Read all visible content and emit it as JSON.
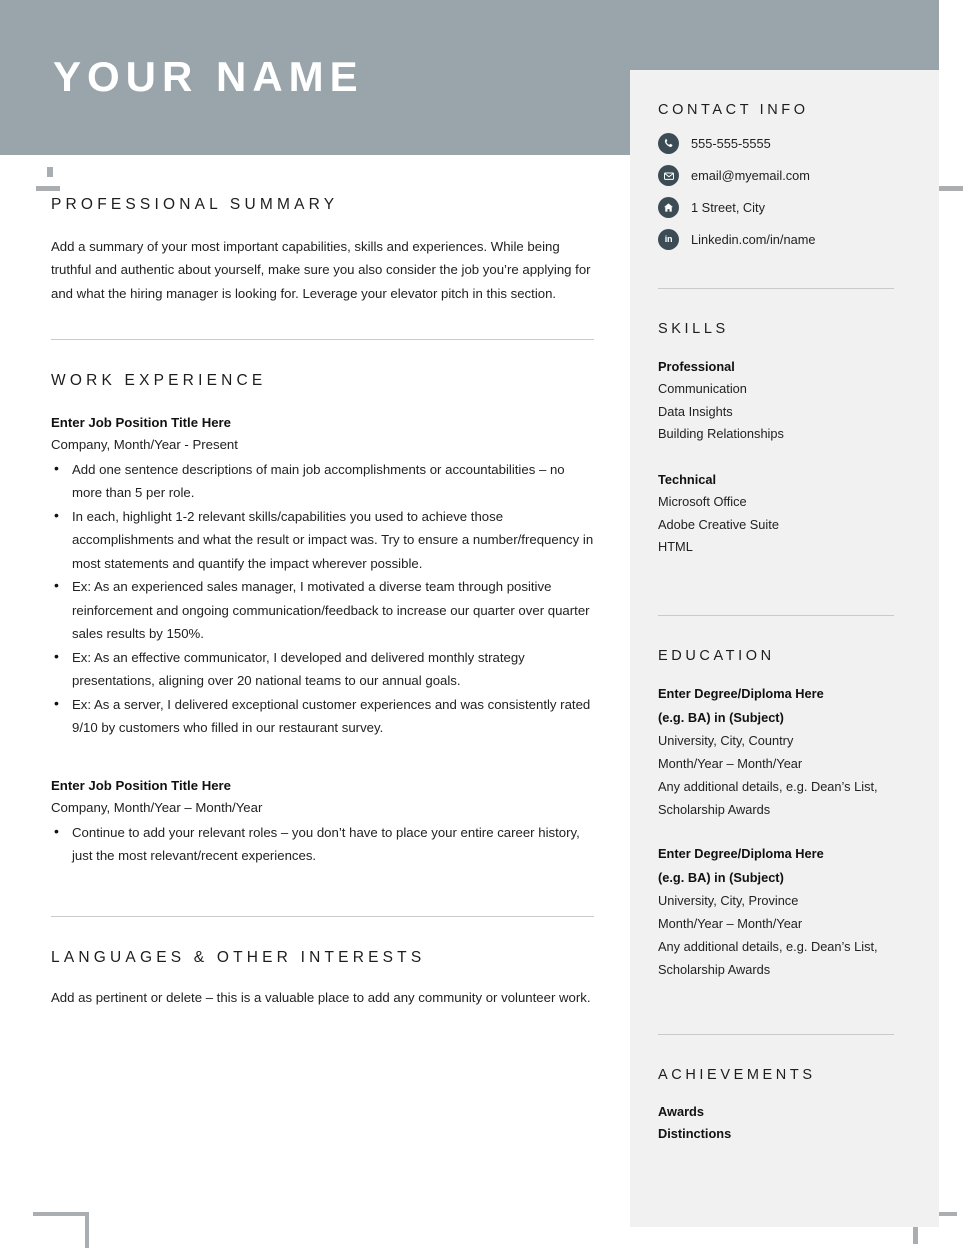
{
  "header": {
    "name": "YOUR NAME",
    "band_color": "#9aa5ab"
  },
  "main": {
    "summary": {
      "title": "PROFESSIONAL SUMMARY",
      "text": "Add a summary of your most important capabilities, skills and experiences. While being truthful and authentic about yourself, make sure you also consider the job you’re applying for and what the hiring manager is looking for. Leverage your elevator pitch in this section."
    },
    "work": {
      "title": "WORK EXPERIENCE",
      "jobs": [
        {
          "title": "Enter Job Position Title Here",
          "meta": "Company, Month/Year - Present",
          "bullets": [
            "Add one sentence descriptions of main job accomplishments or accountabilities – no more than 5 per role.",
            "In each, highlight 1-2 relevant skills/capabilities you used to achieve those accomplishments and what the result or impact was. Try to ensure a number/frequency in most statements and quantify the impact wherever possible.",
            "Ex: As an experienced sales manager, I motivated a diverse team through positive reinforcement and ongoing communication/feedback to increase our quarter over quarter sales results by 150%.",
            "Ex: As an effective communicator, I developed and delivered monthly strategy presentations, aligning over 20 national teams to our annual goals.",
            "Ex: As a server, I delivered exceptional customer experiences and was consistently rated 9/10 by customers who filled in our restaurant survey."
          ]
        },
        {
          "title": "Enter Job Position Title Here",
          "meta": "Company, Month/Year – Month/Year",
          "bullets": [
            "Continue to add your relevant roles – you don’t have to place your entire career history, just the most relevant/recent experiences."
          ]
        }
      ]
    },
    "languages": {
      "title": "LANGUAGES & OTHER INTERESTS",
      "text": "Add as pertinent or delete – this is a valuable place to add any community or volunteer work."
    }
  },
  "sidebar": {
    "contact": {
      "title": "CONTACT INFO",
      "items": [
        {
          "icon": "phone-icon",
          "value": "555-555-5555"
        },
        {
          "icon": "email-icon",
          "value": "email@myemail.com"
        },
        {
          "icon": "home-icon",
          "value": "1 Street, City"
        },
        {
          "icon": "linkedin-icon",
          "value": "Linkedin.com/in/name"
        }
      ],
      "icon_color": "#3c4c55"
    },
    "skills": {
      "title": "SKILLS",
      "groups": [
        {
          "name": "Professional",
          "items": [
            "Communication",
            "Data Insights",
            "Building Relationships"
          ]
        },
        {
          "name": "Technical",
          "items": [
            "Microsoft Office",
            "Adobe Creative Suite",
            "HTML"
          ]
        }
      ]
    },
    "education": {
      "title": "EDUCATION",
      "entries": [
        {
          "degree_line1": "Enter Degree/Diploma Here",
          "degree_line2": "(e.g. BA) in (Subject)",
          "institution": "University, City, Country",
          "dates": "Month/Year – Month/Year",
          "details": "Any additional details, e.g. Dean’s List, Scholarship Awards"
        },
        {
          "degree_line1": "Enter Degree/Diploma Here",
          "degree_line2": "(e.g. BA) in (Subject)",
          "institution": "University, City, Province",
          "dates": "Month/Year – Month/Year",
          "details": "Any additional details, e.g. Dean’s List, Scholarship Awards"
        }
      ]
    },
    "achievements": {
      "title": "ACHIEVEMENTS",
      "items": [
        "Awards",
        "Distinctions"
      ]
    }
  }
}
